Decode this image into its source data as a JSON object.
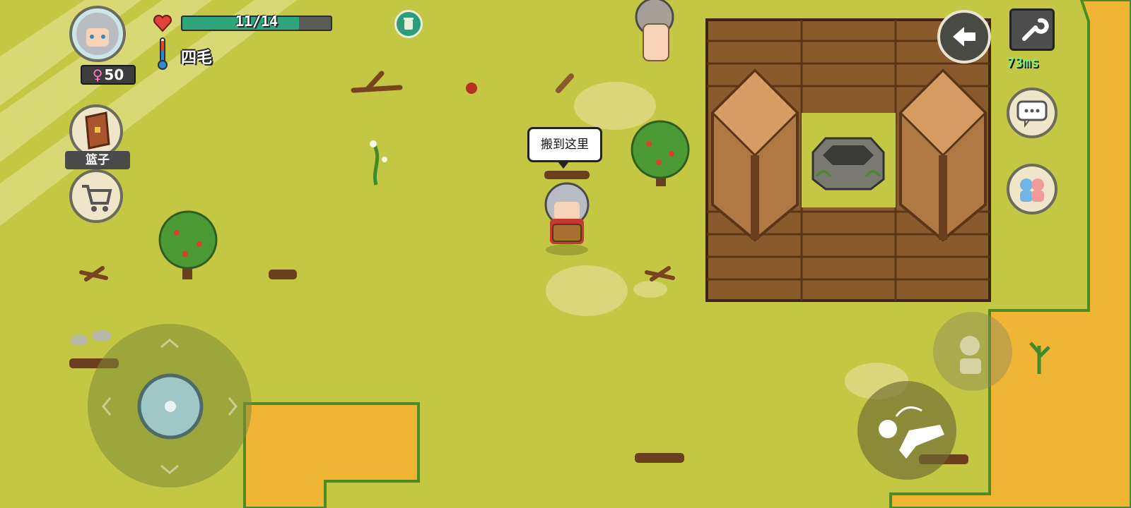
{
  "player": {
    "name": "四毛",
    "age": "50",
    "health_text": "11/14",
    "health": {
      "current": 11,
      "max": 14
    }
  },
  "hud": {
    "held_item_label": "篮子",
    "ping_text": "73ms"
  },
  "speech_bubble": "搬到这里",
  "icons": {
    "heart": "heart-icon",
    "thermometer": "thermometer-icon",
    "trash": "trash-icon",
    "basket": "basket-icon",
    "cart": "shopping-cart-icon",
    "back": "back-arrow-icon",
    "settings": "wrench-icon",
    "chat": "chat-bubble-icon",
    "family": "family-icon",
    "joystick": "joystick-icon",
    "pick_up": "pick-up-hand-icon",
    "drop": "drop-item-icon"
  },
  "colors": {
    "grass": "#c3c743",
    "sand": "#f1b535",
    "health_fill": "#2ea57a",
    "ping": "#7ef27a",
    "wood_floor": "#8a5a2c"
  }
}
